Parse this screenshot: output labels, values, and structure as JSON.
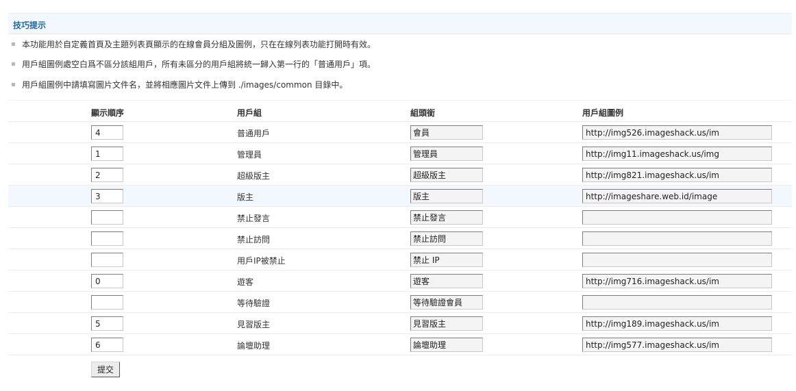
{
  "tips": {
    "title": "技巧提示",
    "items": [
      "本功能用於自定義首頁及主題列表頁顯示的在線會員分組及圖例，只在在線列表功能打開時有效。",
      "用戶組圖例處空白爲不區分該組用戶，所有未區分的用戶組將統一歸入第一行的「普通用戶」項。",
      "用戶組圖例中請填寫圖片文件名，並將相應圖片文件上傳到 ./images/common 目錄中。"
    ]
  },
  "table": {
    "columns": [
      "顯示順序",
      "用戶組",
      "組頭銜",
      "用戶組圖例"
    ],
    "rows": [
      {
        "order": "4",
        "group": "普通用戶",
        "title": "會員",
        "icon": "http://img526.imageshack.us/im"
      },
      {
        "order": "1",
        "group": "管理員",
        "title": "管理員",
        "icon": "http://img11.imageshack.us/img"
      },
      {
        "order": "2",
        "group": "超級版主",
        "title": "超級版主",
        "icon": "http://img821.imageshack.us/im"
      },
      {
        "order": "3",
        "group": "版主",
        "title": "版主",
        "icon": "http://imageshare.web.id/image"
      },
      {
        "order": "",
        "group": "禁止發言",
        "title": "禁止發言",
        "icon": ""
      },
      {
        "order": "",
        "group": "禁止訪問",
        "title": "禁止訪問",
        "icon": ""
      },
      {
        "order": "",
        "group": "用戶IP被禁止",
        "title": "禁止 IP",
        "icon": ""
      },
      {
        "order": "0",
        "group": "遊客",
        "title": "遊客",
        "icon": "http://img716.imageshack.us/im"
      },
      {
        "order": "",
        "group": "等待驗證",
        "title": "等待驗證會員",
        "icon": ""
      },
      {
        "order": "5",
        "group": "見習版主",
        "title": "見習版主",
        "icon": "http://img189.imageshack.us/im"
      },
      {
        "order": "6",
        "group": "論壇助理",
        "title": "論壇助理",
        "icon": "http://img577.imageshack.us/im"
      }
    ],
    "highlighted_row": 3
  },
  "submit_label": "提交"
}
